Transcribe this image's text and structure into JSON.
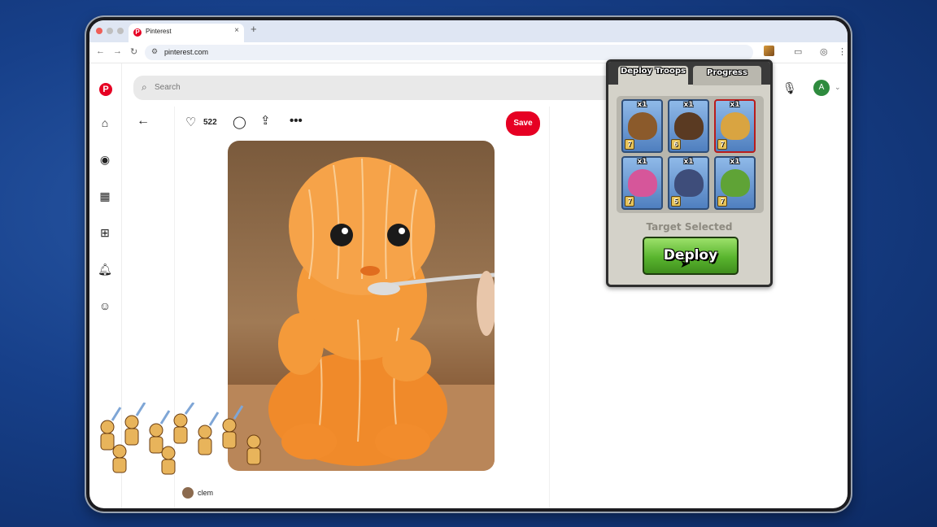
{
  "browser": {
    "tab_title": "Pinterest",
    "tab_close": "×",
    "new_tab": "+",
    "url": "pinterest.com",
    "back": "←",
    "forward": "→",
    "reload": "↻"
  },
  "pinterest": {
    "logo": "P",
    "search_placeholder": "Search",
    "user_initial": "A",
    "pin": {
      "like_count": "522",
      "save_label": "Save",
      "creator": "clem"
    }
  },
  "game": {
    "tabs": [
      {
        "label": "Deploy Troops",
        "active": true
      },
      {
        "label": "Progress",
        "active": false
      }
    ],
    "troops": [
      {
        "count": "x1",
        "level": "7",
        "unit": "balloon",
        "color": "#8b5a2b"
      },
      {
        "count": "x1",
        "level": "6",
        "unit": "hog-rider",
        "color": "#5a3a22"
      },
      {
        "count": "x1",
        "level": "7",
        "unit": "barbarian",
        "color": "#d9a441"
      },
      {
        "count": "x1",
        "level": "7",
        "unit": "archer",
        "color": "#d6569a"
      },
      {
        "count": "x1",
        "level": "5",
        "unit": "pekka",
        "color": "#3e4d7a"
      },
      {
        "count": "x1",
        "level": "7",
        "unit": "goblin",
        "color": "#5fa336"
      }
    ],
    "status": "Target Selected",
    "deploy_label": "Deploy"
  }
}
